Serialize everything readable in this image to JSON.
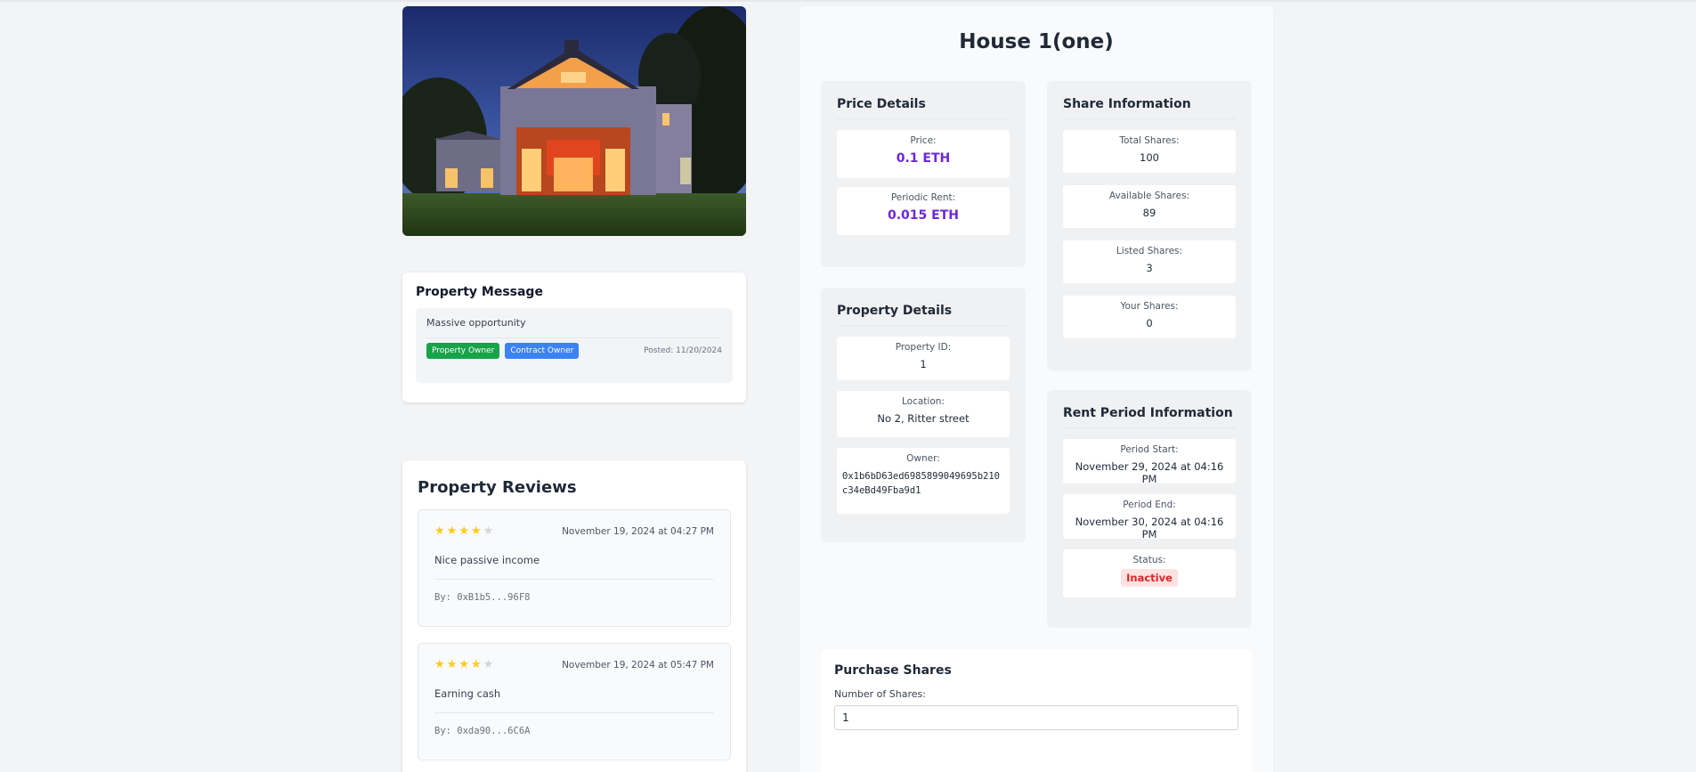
{
  "property": {
    "title": "House 1(one)"
  },
  "message": {
    "heading": "Property Message",
    "text": "Massive opportunity",
    "badges": [
      "Property Owner",
      "Contract Owner"
    ],
    "posted": "Posted: 11/20/2024"
  },
  "reviews": {
    "heading": "Property Reviews",
    "items": [
      {
        "rating": 4,
        "max": 5,
        "date": "November 19, 2024 at 04:27 PM",
        "text": "Nice passive income",
        "by": "By: 0xB1b5...96F8"
      },
      {
        "rating": 4,
        "max": 5,
        "date": "November 19, 2024 at 05:47 PM",
        "text": "Earning cash",
        "by": "By: 0xda90...6C6A"
      }
    ]
  },
  "price": {
    "heading": "Price Details",
    "price_label": "Price:",
    "price_value": "0.1 ETH",
    "rent_label": "Periodic Rent:",
    "rent_value": "0.015 ETH"
  },
  "shares": {
    "heading": "Share Information",
    "total_label": "Total Shares:",
    "total_value": "100",
    "available_label": "Available Shares:",
    "available_value": "89",
    "listed_label": "Listed Shares:",
    "listed_value": "3",
    "yours_label": "Your Shares:",
    "yours_value": "0"
  },
  "details": {
    "heading": "Property Details",
    "id_label": "Property ID:",
    "id_value": "1",
    "location_label": "Location:",
    "location_value": "No 2, Ritter street",
    "owner_label": "Owner:",
    "owner_line1": "0x1b6bD63ed6985899049695b210",
    "owner_line2": "c34eBd49Fba9d1"
  },
  "rent_period": {
    "heading": "Rent Period Information",
    "start_label": "Period Start:",
    "start_value": "November 29, 2024 at 04:16 PM",
    "end_label": "Period End:",
    "end_value": "November 30, 2024 at 04:16 PM",
    "status_label": "Status:",
    "status_value": "Inactive"
  },
  "purchase": {
    "heading": "Purchase Shares",
    "field_label": "Number of Shares:",
    "field_value": "1"
  },
  "colors": {
    "eth_accent": "#6d28d9",
    "badge_green": "#16a34a",
    "badge_blue": "#3b82f6",
    "status_red": "#dc2626",
    "star_yellow": "#facc15"
  }
}
